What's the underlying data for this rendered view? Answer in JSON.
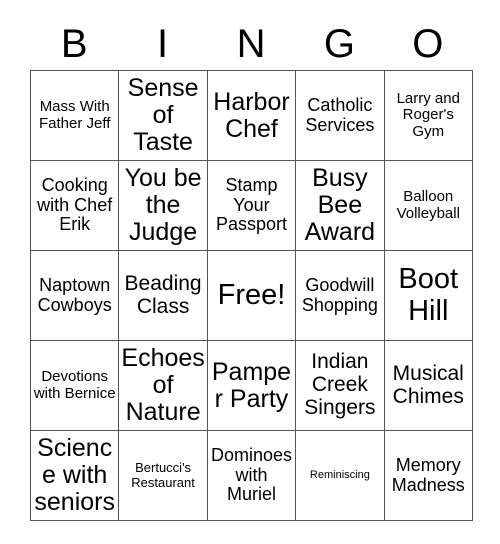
{
  "card": {
    "type": "bingo-card",
    "header_letters": [
      "B",
      "I",
      "N",
      "G",
      "O"
    ],
    "columns": 5,
    "rows": 5,
    "free_space": {
      "row": 2,
      "col": 2,
      "label": "Free!"
    },
    "colors": {
      "background": "#ffffff",
      "text": "#000000",
      "grid_line": "#555555"
    },
    "rows_data": [
      [
        {
          "text": "Mass With Father Jeff",
          "size": "fs-sm"
        },
        {
          "text": "Sense of Taste",
          "size": "fs-xl"
        },
        {
          "text": "Harbor Chef",
          "size": "fs-xl"
        },
        {
          "text": "Catholic Services",
          "size": "fs-md"
        },
        {
          "text": "Larry and Roger's Gym",
          "size": "fs-sm"
        }
      ],
      [
        {
          "text": "Cooking with Chef Erik",
          "size": "fs-md"
        },
        {
          "text": "You be the Judge",
          "size": "fs-xl"
        },
        {
          "text": "Stamp Your Passport",
          "size": "fs-md"
        },
        {
          "text": "Busy Bee Award",
          "size": "fs-xl"
        },
        {
          "text": "Balloon Volleyball",
          "size": "fs-sm"
        }
      ],
      [
        {
          "text": "Naptown Cowboys",
          "size": "fs-md"
        },
        {
          "text": "Beading Class",
          "size": "fs-lg"
        },
        {
          "text": "Free!",
          "size": "fs-xxl"
        },
        {
          "text": "Goodwill Shopping",
          "size": "fs-md"
        },
        {
          "text": "Boot Hill",
          "size": "fs-xxl"
        }
      ],
      [
        {
          "text": "Devotions with Bernice",
          "size": "fs-sm"
        },
        {
          "text": "Echoes of Nature",
          "size": "fs-xl"
        },
        {
          "text": "Pamper Party",
          "size": "fs-xl"
        },
        {
          "text": "Indian Creek Singers",
          "size": "fs-lg"
        },
        {
          "text": "Musical Chimes",
          "size": "fs-lg"
        }
      ],
      [
        {
          "text": "Science with seniors",
          "size": "fs-xl"
        },
        {
          "text": "Bertucci's Restaurant",
          "size": "fs-xs"
        },
        {
          "text": "Dominoes with Muriel",
          "size": "fs-md"
        },
        {
          "text": "Reminiscing",
          "size": "fs-xxs"
        },
        {
          "text": "Memory Madness",
          "size": "fs-md"
        }
      ]
    ]
  }
}
